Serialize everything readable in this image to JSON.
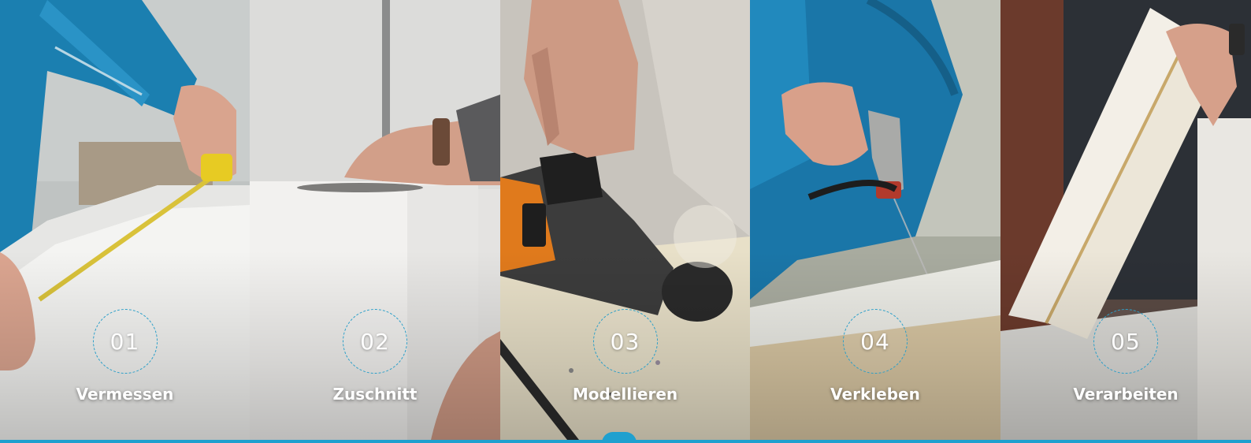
{
  "active_step": 3,
  "colors": {
    "accent": "#1fa0cf",
    "ring": "#2a9fc9",
    "text": "#ffffff"
  },
  "steps": [
    {
      "number": "01",
      "label": "Vermessen",
      "image": "photo-measuring-tape-on-foam"
    },
    {
      "number": "02",
      "label": "Zuschnitt",
      "image": "photo-cutting-foam-block"
    },
    {
      "number": "03",
      "label": "Modellieren",
      "image": "photo-grinding-foam"
    },
    {
      "number": "04",
      "label": "Verkleben",
      "image": "photo-spray-gluing"
    },
    {
      "number": "05",
      "label": "Verarbeiten",
      "image": "photo-foam-panel"
    }
  ]
}
